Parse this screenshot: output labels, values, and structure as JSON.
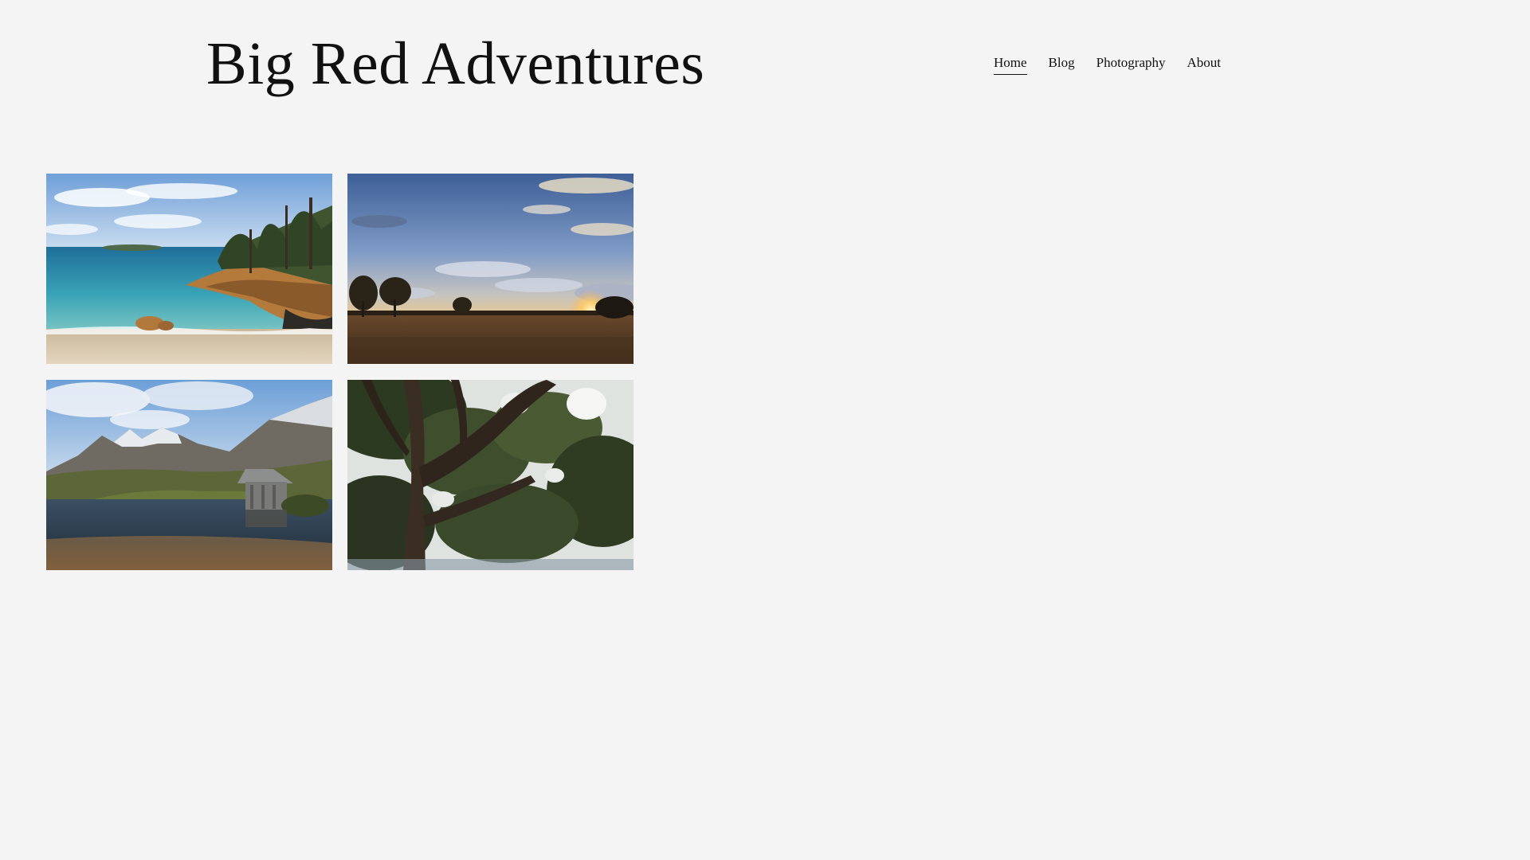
{
  "site": {
    "title": "Big Red Adventures"
  },
  "nav": {
    "items": [
      {
        "label": "Home",
        "active": true
      },
      {
        "label": "Blog",
        "active": false
      },
      {
        "label": "Photography",
        "active": false
      },
      {
        "label": "About",
        "active": false
      }
    ]
  },
  "gallery": {
    "photos": [
      {
        "icon": "coastal-beach-photo"
      },
      {
        "icon": "sunset-field-photo"
      },
      {
        "icon": "mountain-boatshed-photo"
      },
      {
        "icon": "eucalyptus-tree-photo"
      }
    ]
  },
  "colors": {
    "background": "#f4f4f4",
    "text": "#111111"
  }
}
